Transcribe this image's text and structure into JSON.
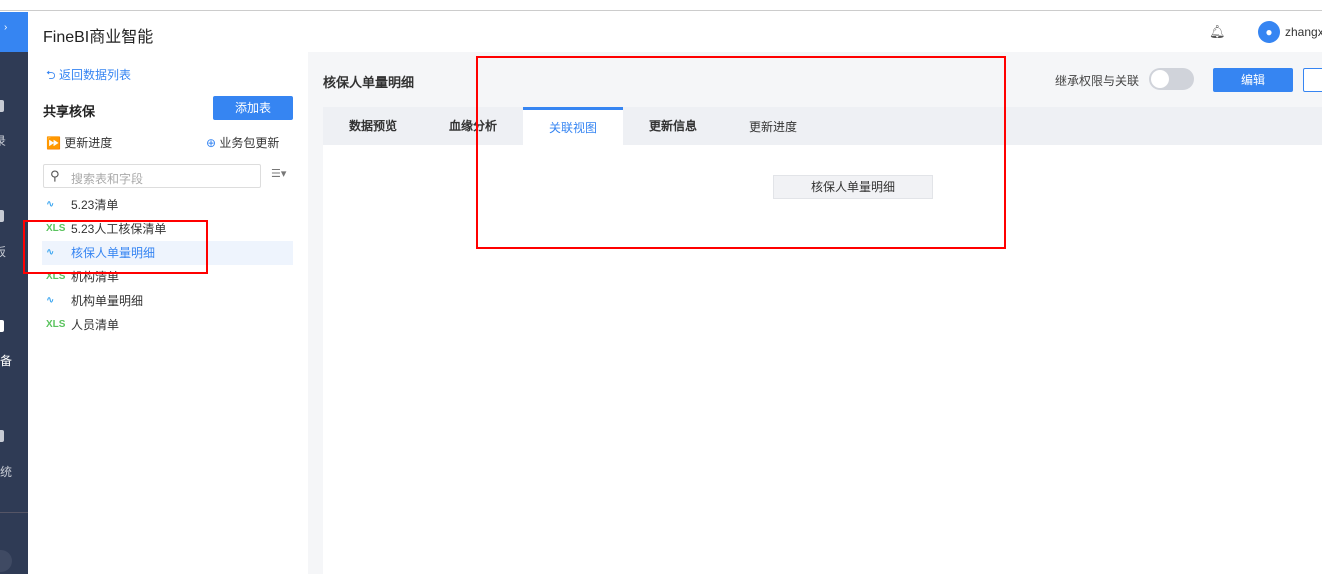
{
  "app": {
    "title": "FineBI商业智能",
    "user": "zhangx"
  },
  "nav": {
    "items": [
      "录",
      "板",
      "准备",
      "系统"
    ]
  },
  "left": {
    "back": "返回数据列表",
    "package": "共享核保",
    "add_table": "添加表",
    "update_progress": "更新进度",
    "package_update": "业务包更新",
    "search_placeholder": "搜索表和字段",
    "tables": [
      {
        "name": "5.23清单",
        "type": "etl"
      },
      {
        "name": "5.23人工核保清单",
        "type": "xls"
      },
      {
        "name": "核保人单量明细",
        "type": "etl",
        "selected": true
      },
      {
        "name": "机构清单",
        "type": "xls"
      },
      {
        "name": "机构单量明细",
        "type": "etl"
      },
      {
        "name": "人员清单",
        "type": "xls"
      }
    ]
  },
  "main": {
    "title": "核保人单量明细",
    "inherit_label": "继承权限与关联",
    "inherit_on": false,
    "edit": "编辑",
    "tabs": [
      "数据预览",
      "血缘分析",
      "关联视图",
      "更新信息"
    ],
    "active_tab": "关联视图",
    "tab_link": "更新进度",
    "node": "核保人单量明细"
  },
  "colors": {
    "accent": "#3685f2",
    "nav": "#2f3b55",
    "annotation": "#ff0000"
  }
}
